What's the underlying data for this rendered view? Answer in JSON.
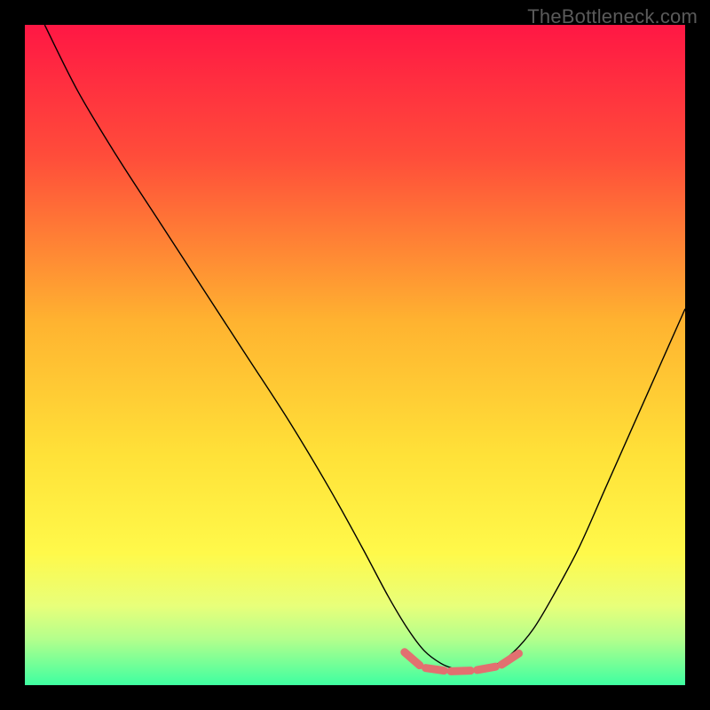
{
  "watermark": "TheBottleneck.com",
  "chart_data": {
    "type": "line",
    "title": "",
    "xlabel": "",
    "ylabel": "",
    "xlim": [
      0,
      100
    ],
    "ylim": [
      0,
      100
    ],
    "background": {
      "type": "linear-gradient",
      "stops": [
        {
          "offset": 0,
          "color": "#ff1744"
        },
        {
          "offset": 0.2,
          "color": "#ff4d3a"
        },
        {
          "offset": 0.45,
          "color": "#ffb330"
        },
        {
          "offset": 0.65,
          "color": "#ffe138"
        },
        {
          "offset": 0.8,
          "color": "#fff94a"
        },
        {
          "offset": 0.88,
          "color": "#e8ff7a"
        },
        {
          "offset": 0.93,
          "color": "#b4ff8c"
        },
        {
          "offset": 1.0,
          "color": "#3effa1"
        }
      ]
    },
    "series": [
      {
        "name": "curve",
        "color": "#000000",
        "stroke_width": 1.4,
        "points": [
          [
            3,
            100
          ],
          [
            8,
            90
          ],
          [
            14,
            80
          ],
          [
            20.5,
            70
          ],
          [
            27,
            60
          ],
          [
            33.5,
            50
          ],
          [
            40,
            40
          ],
          [
            46,
            30
          ],
          [
            51,
            21
          ],
          [
            55,
            13.5
          ],
          [
            58,
            8.5
          ],
          [
            60.5,
            5.2
          ],
          [
            63,
            3.3
          ],
          [
            65,
            2.5
          ],
          [
            67,
            2.2
          ],
          [
            69,
            2.4
          ],
          [
            71.5,
            3.2
          ],
          [
            74,
            5.0
          ],
          [
            77,
            8.5
          ],
          [
            80,
            13.5
          ],
          [
            84,
            21
          ],
          [
            88,
            30
          ],
          [
            92,
            39
          ],
          [
            96,
            48
          ],
          [
            100,
            57
          ]
        ]
      },
      {
        "name": "bottom-markers",
        "color": "#e27070",
        "type": "scatter-segments",
        "segments": [
          [
            [
              57.5,
              5.0
            ],
            [
              59.8,
              3.0
            ]
          ],
          [
            [
              60.7,
              2.6
            ],
            [
              63.5,
              2.2
            ]
          ],
          [
            [
              64.5,
              2.1
            ],
            [
              67.5,
              2.2
            ]
          ],
          [
            [
              68.5,
              2.3
            ],
            [
              71.3,
              2.8
            ]
          ],
          [
            [
              72.2,
              3.1
            ],
            [
              74.8,
              4.8
            ]
          ]
        ]
      }
    ]
  }
}
